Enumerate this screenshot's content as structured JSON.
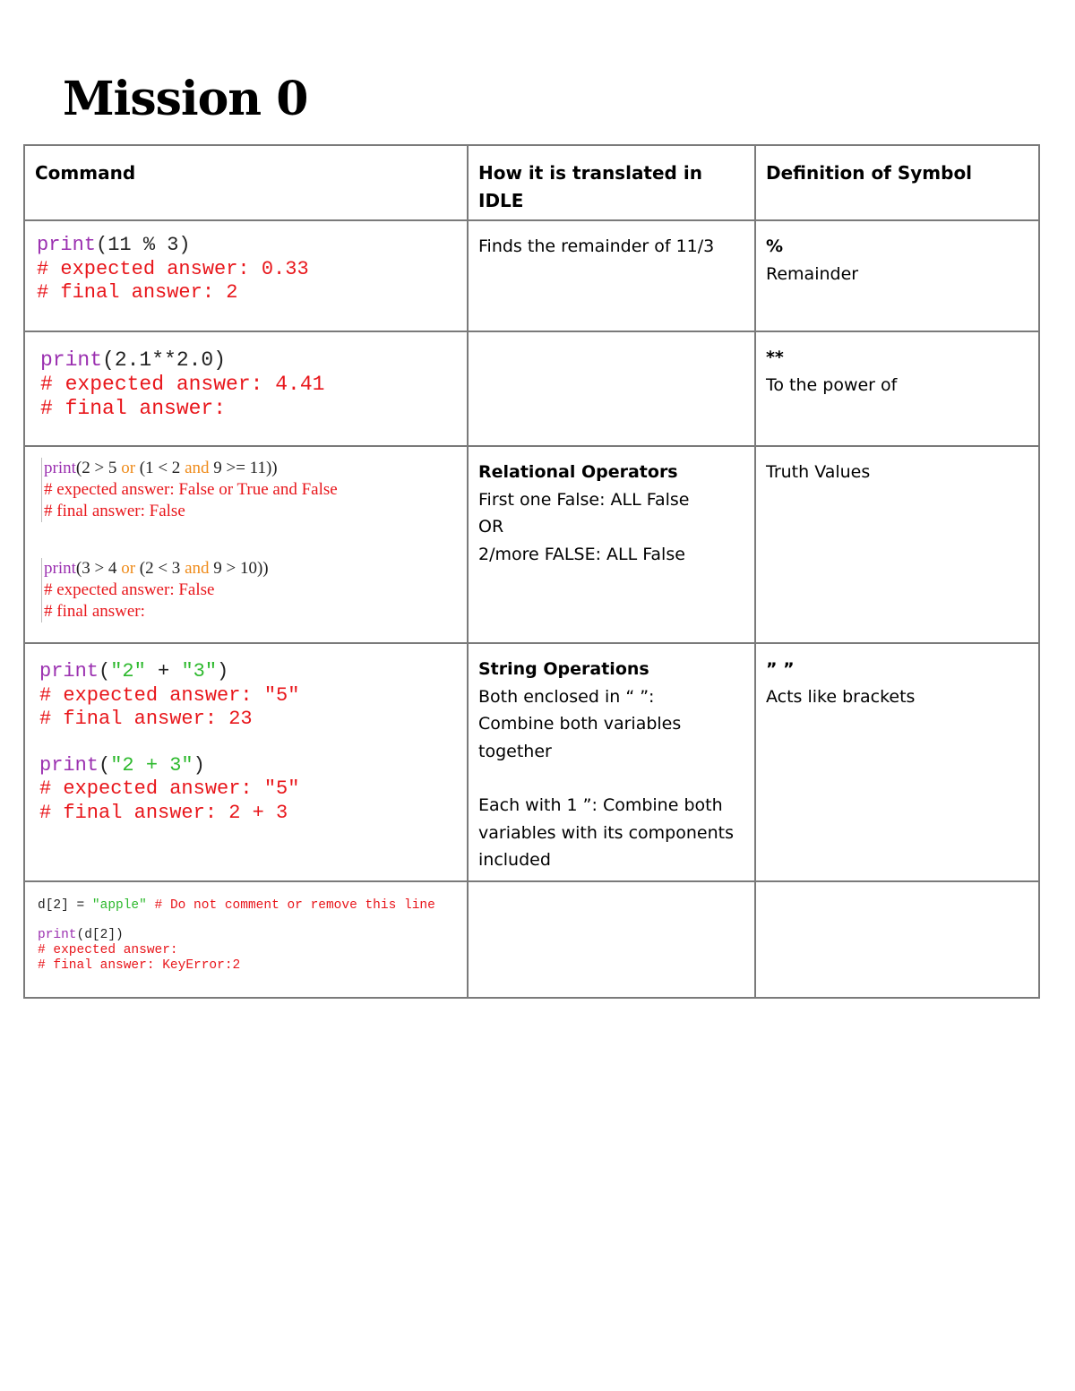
{
  "title": "Mission 0",
  "table": {
    "headers": [
      "Command",
      "How it is translated in IDLE",
      "Definition of Symbol"
    ],
    "rows": [
      {
        "command": {
          "lines": [
            {
              "parts": [
                {
                  "t": "print",
                  "c": "kw"
                },
                {
                  "t": "(11 % 3)",
                  "c": "pl"
                }
              ]
            },
            {
              "parts": [
                {
                  "t": "# expected answer: 0.33",
                  "c": "cm"
                }
              ]
            },
            {
              "parts": [
                {
                  "t": "# final answer: 2",
                  "c": "cm"
                }
              ]
            }
          ]
        },
        "translation": {
          "heading": "",
          "lines": [
            "Finds the remainder of 11/3"
          ]
        },
        "definition": {
          "symbol": "%",
          "meaning": "Remainder"
        }
      },
      {
        "command": {
          "lines": [
            {
              "parts": [
                {
                  "t": "print",
                  "c": "kw"
                },
                {
                  "t": "(2.1**2.0)",
                  "c": "pl"
                }
              ]
            },
            {
              "parts": [
                {
                  "t": "# expected answer: 4.41",
                  "c": "cm"
                }
              ]
            },
            {
              "parts": [
                {
                  "t": "# final answer:",
                  "c": "cm"
                }
              ]
            }
          ]
        },
        "translation": {
          "heading": "",
          "lines": []
        },
        "definition": {
          "symbol": "**",
          "meaning": "To the power of"
        }
      },
      {
        "command": {
          "blocks": [
            [
              {
                "parts": [
                  {
                    "t": "print",
                    "c": "kw"
                  },
                  {
                    "t": "(2 > 5 ",
                    "c": "pl"
                  },
                  {
                    "t": "or",
                    "c": "op"
                  },
                  {
                    "t": " (1 < 2 ",
                    "c": "pl"
                  },
                  {
                    "t": "and",
                    "c": "op"
                  },
                  {
                    "t": " 9 >= 11))",
                    "c": "pl"
                  }
                ]
              },
              {
                "parts": [
                  {
                    "t": "# expected answer: False or True and False",
                    "c": "cm"
                  }
                ]
              },
              {
                "parts": [
                  {
                    "t": "# final answer: False",
                    "c": "cm"
                  }
                ]
              }
            ],
            [
              {
                "parts": [
                  {
                    "t": "print",
                    "c": "kw"
                  },
                  {
                    "t": "(3 > 4 ",
                    "c": "pl"
                  },
                  {
                    "t": "or",
                    "c": "op"
                  },
                  {
                    "t": " (2 < 3 ",
                    "c": "pl"
                  },
                  {
                    "t": "and",
                    "c": "op"
                  },
                  {
                    "t": " 9 > 10))",
                    "c": "pl"
                  }
                ]
              },
              {
                "parts": [
                  {
                    "t": "# expected answer: False",
                    "c": "cm"
                  }
                ]
              },
              {
                "parts": [
                  {
                    "t": "# final answer:",
                    "c": "cm"
                  }
                ]
              }
            ]
          ]
        },
        "translation": {
          "heading": "Relational Operators",
          "lines": [
            "First one False: ALL False",
            "OR",
            "2/more FALSE: ALL False"
          ]
        },
        "definition": {
          "symbol": "",
          "meaning": "Truth Values"
        }
      },
      {
        "command": {
          "blocks": [
            [
              {
                "parts": [
                  {
                    "t": "print",
                    "c": "kw"
                  },
                  {
                    "t": "(",
                    "c": "pl"
                  },
                  {
                    "t": "\"2\"",
                    "c": "str"
                  },
                  {
                    "t": " + ",
                    "c": "pl"
                  },
                  {
                    "t": "\"3\"",
                    "c": "str"
                  },
                  {
                    "t": ")",
                    "c": "pl"
                  }
                ]
              },
              {
                "parts": [
                  {
                    "t": "# expected answer: \"5\"",
                    "c": "cm"
                  }
                ]
              },
              {
                "parts": [
                  {
                    "t": "# final answer: 23",
                    "c": "cm"
                  }
                ]
              }
            ],
            [
              {
                "parts": [
                  {
                    "t": "print",
                    "c": "kw"
                  },
                  {
                    "t": "(",
                    "c": "pl"
                  },
                  {
                    "t": "\"2 + 3\"",
                    "c": "str"
                  },
                  {
                    "t": ")",
                    "c": "pl"
                  }
                ]
              },
              {
                "parts": [
                  {
                    "t": "# expected answer: \"5\"",
                    "c": "cm"
                  }
                ]
              },
              {
                "parts": [
                  {
                    "t": "# final answer: 2 + 3",
                    "c": "cm"
                  }
                ]
              }
            ]
          ]
        },
        "translation": {
          "heading": "String Operations",
          "lines": [
            "Both enclosed in “ ”:",
            "Combine both variables",
            "together",
            "",
            "Each with 1 ”: Combine both",
            "variables with its components",
            "included"
          ]
        },
        "definition": {
          "symbol": "” ”",
          "meaning": "Acts like brackets"
        }
      },
      {
        "command": {
          "blocks": [
            [
              {
                "parts": [
                  {
                    "t": "d[2] = ",
                    "c": "pl"
                  },
                  {
                    "t": "\"apple\"",
                    "c": "str"
                  },
                  {
                    "t": " # Do not comment or remove this line",
                    "c": "cm"
                  }
                ]
              }
            ],
            [
              {
                "parts": [
                  {
                    "t": "print",
                    "c": "kw"
                  },
                  {
                    "t": "(d[2])",
                    "c": "pl"
                  }
                ]
              },
              {
                "parts": [
                  {
                    "t": "# expected answer:",
                    "c": "cm"
                  }
                ]
              },
              {
                "parts": [
                  {
                    "t": "# final answer: KeyError:2",
                    "c": "cm"
                  }
                ]
              }
            ]
          ]
        },
        "translation": {
          "heading": "",
          "lines": []
        },
        "definition": {
          "symbol": "",
          "meaning": ""
        }
      }
    ]
  }
}
